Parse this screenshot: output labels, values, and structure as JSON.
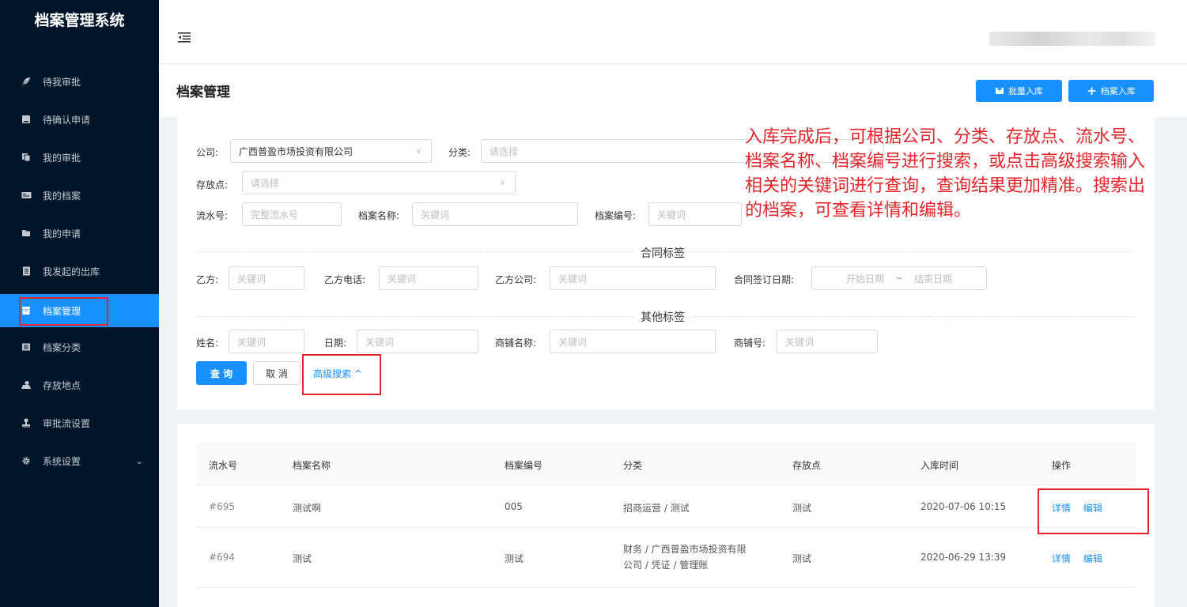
{
  "app": {
    "title": "档案管理系统"
  },
  "sidebar": {
    "items": [
      {
        "label": "待我审批",
        "icon": "feather-icon"
      },
      {
        "label": "待确认申请",
        "icon": "card-icon"
      },
      {
        "label": "我的审批",
        "icon": "copy-icon"
      },
      {
        "label": "我的档案",
        "icon": "id-card-icon"
      },
      {
        "label": "我的申请",
        "icon": "folder-icon"
      },
      {
        "label": "我发起的出库",
        "icon": "document-icon"
      },
      {
        "label": "档案管理",
        "icon": "box-icon",
        "active": true
      },
      {
        "label": "档案分类",
        "icon": "list-icon"
      },
      {
        "label": "存放地点",
        "icon": "map-icon"
      },
      {
        "label": "审批流设置",
        "icon": "stamp-icon"
      },
      {
        "label": "系统设置",
        "icon": "gear-icon",
        "expandable": true
      }
    ]
  },
  "header": {
    "fold_icon": "indent-fold-icon"
  },
  "page": {
    "title": "档案管理",
    "batch_button": "批量入库",
    "add_button": "档案入库"
  },
  "filters": {
    "company_label": "公司:",
    "company_value": "广西普盈市场投资有限公司",
    "category_label": "分类:",
    "category_placeholder": "请选择",
    "location_label": "存放点:",
    "location_placeholder": "请选择",
    "serial_label": "流水号:",
    "serial_placeholder": "完整流水号",
    "name_label": "档案名称:",
    "name_placeholder": "关键词",
    "code_label": "档案编号:",
    "code_placeholder": "关键词",
    "contract_section": "合同标签",
    "party_b_label": "乙方:",
    "party_b_placeholder": "关键词",
    "party_b_phone_label": "乙方电话:",
    "party_b_phone_placeholder": "关键词",
    "party_b_company_label": "乙方公司:",
    "party_b_company_placeholder": "关键词",
    "sign_date_label": "合同签订日期:",
    "start_date_placeholder": "开始日期",
    "date_sep": "~",
    "end_date_placeholder": "结束日期",
    "other_section": "其他标签",
    "person_label": "姓名:",
    "person_placeholder": "关键词",
    "date_label": "日期:",
    "date_placeholder": "关键词",
    "shop_name_label": "商铺名称:",
    "shop_name_placeholder": "关键词",
    "shop_no_label": "商铺号:",
    "shop_no_placeholder": "关键词",
    "query_button": "查 询",
    "cancel_button": "取 消",
    "advanced_link": "高级搜索 ^"
  },
  "annotation": {
    "text": "入库完成后，可根据公司、分类、存放点、流水号、档案名称、档案编号进行搜索，或点击高级搜索输入相关的关键词进行查询，查询结果更加精准。搜索出的档案，可查看详情和编辑。"
  },
  "table": {
    "columns": [
      "流水号",
      "档案名称",
      "档案编号",
      "分类",
      "存放点",
      "入库时间",
      "操作"
    ],
    "rows": [
      {
        "serial": "#695",
        "name": "测试啊",
        "code": "005",
        "category": "招商运营 / 测试",
        "location": "测试",
        "time": "2020-07-06 10:15",
        "detail": "详情",
        "edit": "编辑"
      },
      {
        "serial": "#694",
        "name": "测试",
        "code": "测试",
        "category_line1": "财务 / 广西普盈市场投资有限",
        "category_line2": "公司 / 凭证 / 管理账",
        "location": "测试",
        "time": "2020-06-29 13:39",
        "detail": "详情",
        "edit": "编辑"
      }
    ]
  },
  "colors": {
    "sidebar_bg": "#001529",
    "primary": "#1890ff",
    "highlight": "#e0262b"
  }
}
